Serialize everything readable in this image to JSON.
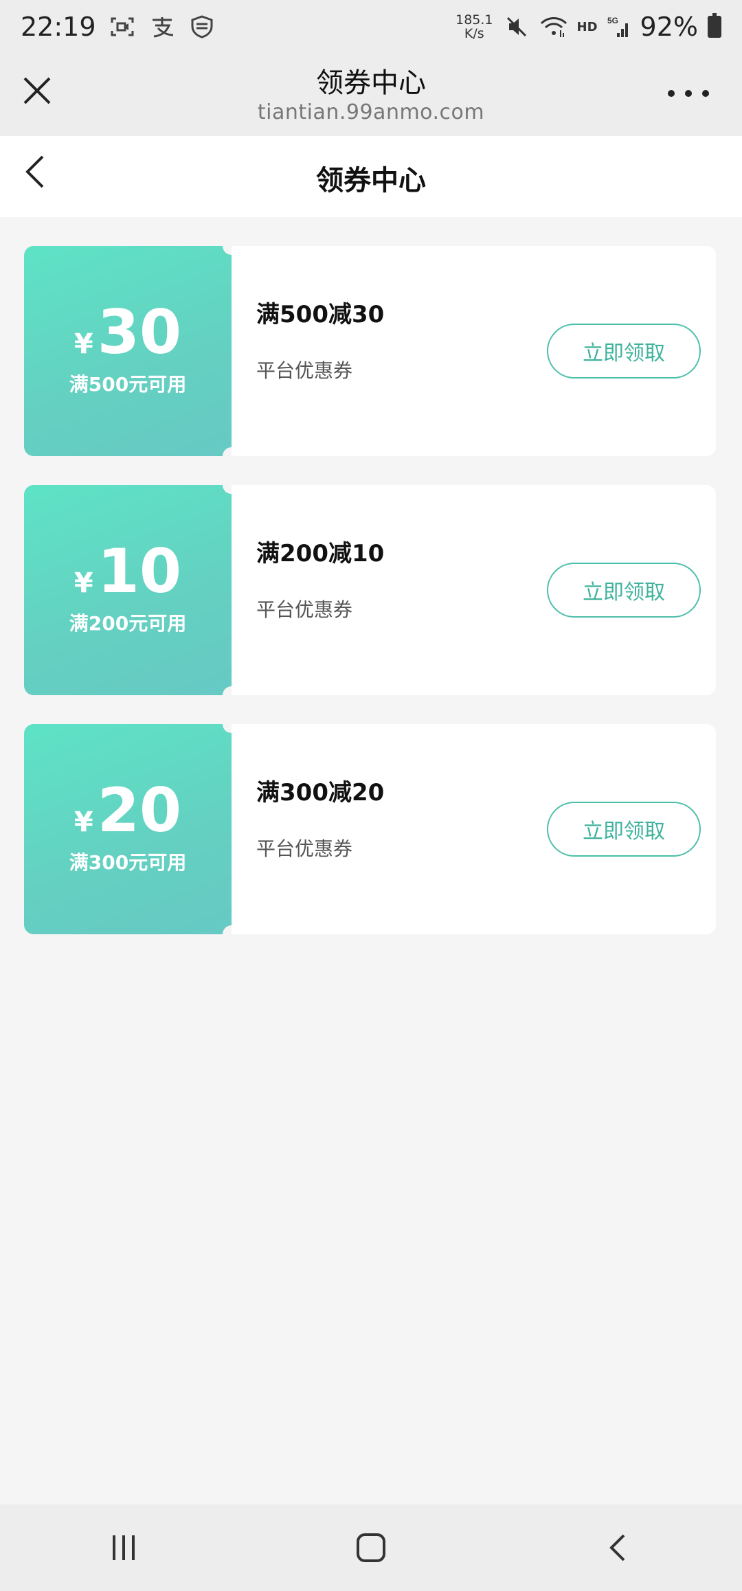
{
  "status_bar": {
    "time": "22:19",
    "net_speed_value": "185.1",
    "net_speed_unit": "K/s",
    "hd": "HD",
    "network": "5G",
    "battery": "92%",
    "icons": [
      "screen-record-icon",
      "alipay-icon",
      "shield-icon",
      "mute-icon",
      "wifi-icon",
      "signal-icon",
      "battery-icon"
    ]
  },
  "browser": {
    "title": "领券中心",
    "url": "tiantian.99anmo.com"
  },
  "page": {
    "title": "领券中心"
  },
  "coupons": [
    {
      "currency": "¥",
      "amount": "30",
      "condition": "满500元可用",
      "name": "满500减30",
      "type": "平台优惠券",
      "button": "立即领取"
    },
    {
      "currency": "¥",
      "amount": "10",
      "condition": "满200元可用",
      "name": "满200减10",
      "type": "平台优惠券",
      "button": "立即领取"
    },
    {
      "currency": "¥",
      "amount": "20",
      "condition": "满300元可用",
      "name": "满300减20",
      "type": "平台优惠券",
      "button": "立即领取"
    }
  ],
  "colors": {
    "accent": "#4cbfa9",
    "coupon_gradient_start": "#5ee3c6",
    "coupon_gradient_end": "#67c9c4",
    "background": "#f5f5f5"
  }
}
